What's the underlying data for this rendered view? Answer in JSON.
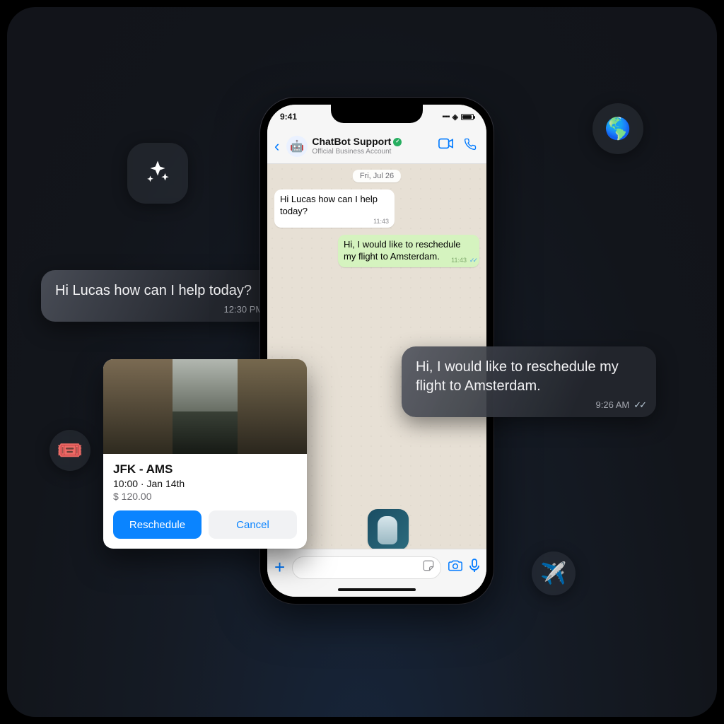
{
  "phone": {
    "status_time": "9:41",
    "title": "ChatBot Support",
    "subtitle": "Official Business Account",
    "date_label": "Fri, Jul 26",
    "msg_in_1": "Hi Lucas how can I help today?",
    "msg_in_1_time": "11:43",
    "msg_out_1": "Hi, I would like to reschedule my flight to Amsterdam.",
    "msg_out_1_time": "11:43"
  },
  "floating": {
    "bubble1_text": "Hi Lucas how can I help today?",
    "bubble1_time": "12:30 PM",
    "bubble2_text": "Hi, I would like to reschedule my flight to Amsterdam.",
    "bubble2_time": "9:26 AM"
  },
  "card": {
    "route": "JFK - AMS",
    "datetime": "10:00 · Jan 14th",
    "price": "$ 120.00",
    "primary_label": "Reschedule",
    "secondary_label": "Cancel"
  },
  "icons": {
    "globe": "🌎",
    "plane": "✈️",
    "ticket": "🎟️"
  }
}
